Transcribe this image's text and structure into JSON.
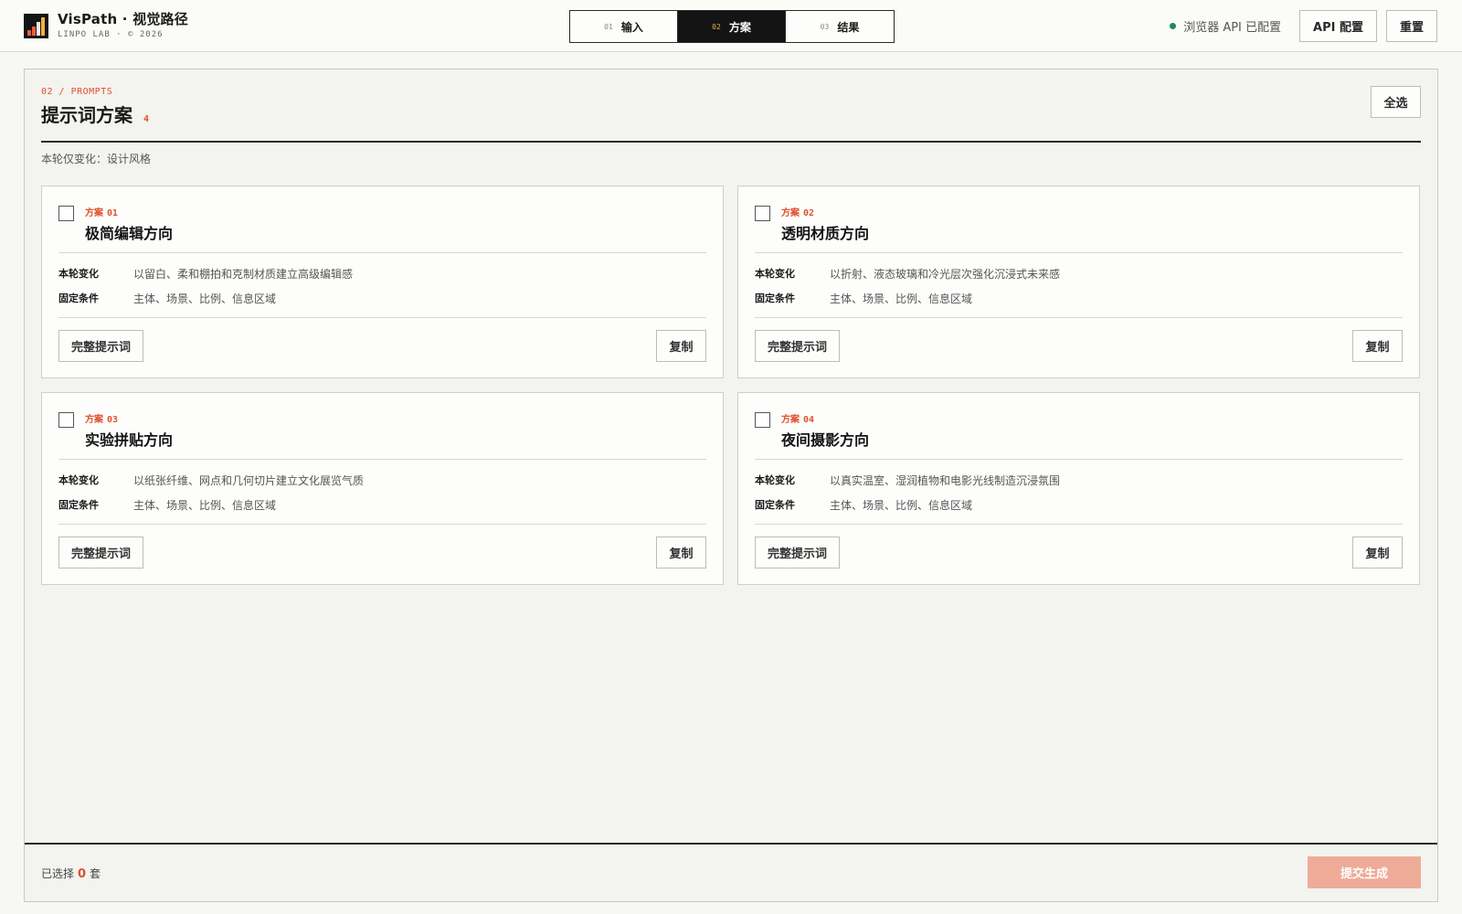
{
  "brand": {
    "title": "VisPath · 视觉路径",
    "subtitle": "LINPO LAB · © 2026"
  },
  "steps": [
    {
      "num": "01",
      "label": "输入",
      "active": false
    },
    {
      "num": "02",
      "label": "方案",
      "active": true
    },
    {
      "num": "03",
      "label": "结果",
      "active": false
    }
  ],
  "topbar": {
    "api_status": "浏览器 API 已配置",
    "api_status_color": "#1f8a5b",
    "api_config_label": "API 配置",
    "reset_label": "重置"
  },
  "panel": {
    "crumb": "02 / PROMPTS",
    "title": "提示词方案",
    "count": "4",
    "select_all_label": "全选",
    "round_note": "本轮仅变化：设计风格"
  },
  "labels": {
    "change": "本轮变化",
    "fixed": "固定条件",
    "full_prompt": "完整提示词",
    "copy": "复制",
    "plan_tag": "方案"
  },
  "cards": [
    {
      "num": "01",
      "title": "极简编辑方向",
      "change": "以留白、柔和棚拍和克制材质建立高级编辑感",
      "fixed": "主体、场景、比例、信息区域",
      "checked": false
    },
    {
      "num": "02",
      "title": "透明材质方向",
      "change": "以折射、液态玻璃和冷光层次强化沉浸式未来感",
      "fixed": "主体、场景、比例、信息区域",
      "checked": false
    },
    {
      "num": "03",
      "title": "实验拼贴方向",
      "change": "以纸张纤维、网点和几何切片建立文化展览气质",
      "fixed": "主体、场景、比例、信息区域",
      "checked": false
    },
    {
      "num": "04",
      "title": "夜间摄影方向",
      "change": "以真实温室、湿润植物和电影光线制造沉浸氛围",
      "fixed": "主体、场景、比例、信息区域",
      "checked": false
    }
  ],
  "footer": {
    "selected_prefix": "已选择",
    "selected_count": "0",
    "selected_suffix": "套",
    "submit_label": "提交生成"
  },
  "colors": {
    "accent": "#e0502d",
    "submit_disabled": "#eeac98",
    "active_step_bg": "#141414"
  }
}
